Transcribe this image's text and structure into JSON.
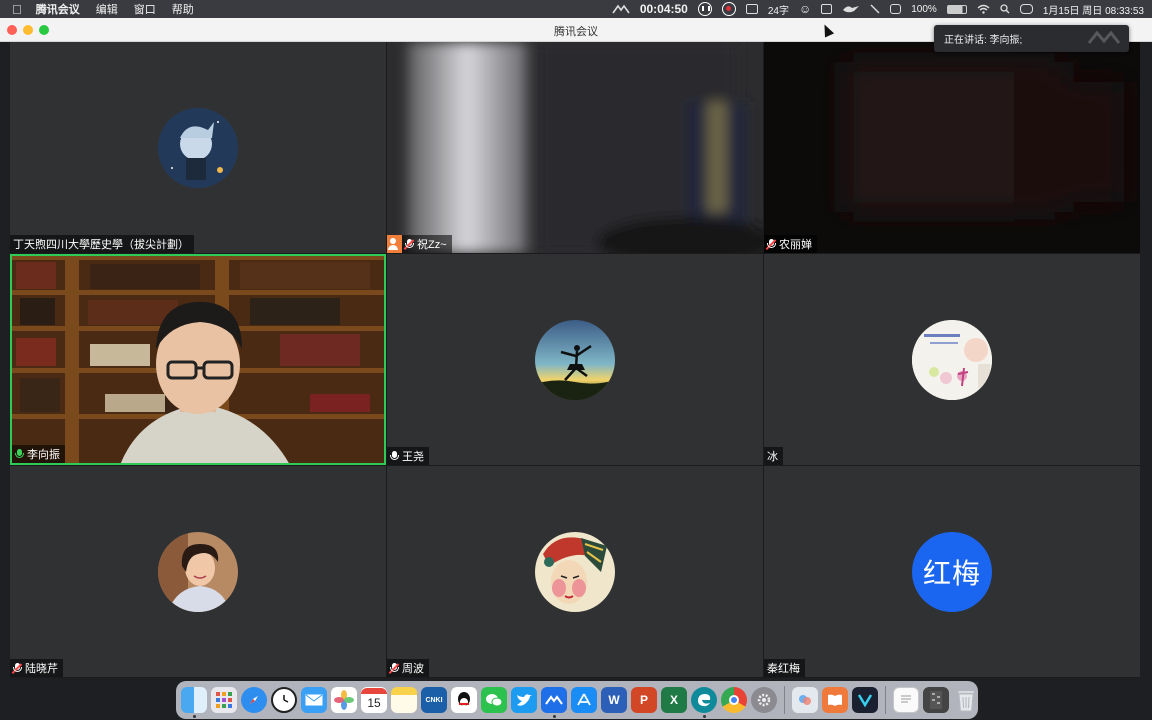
{
  "menubar": {
    "apple_icon": "apple-logo",
    "app_name": "腾讯会议",
    "menus": [
      "编辑",
      "窗口",
      "帮助"
    ],
    "timer": "00:04:50",
    "input_indicator": "24字",
    "battery": "100%",
    "datetime": "1月15日 周日  08:33:53"
  },
  "window": {
    "title": "腾讯会议"
  },
  "speaking": {
    "label": "正在讲话: 李向振;"
  },
  "colors": {
    "active_speaker": "#2ecc57",
    "tile_bg": "#303133",
    "hongmei_avatar": "#1a66f0"
  },
  "participants": [
    {
      "name": "丁天煦四川大學歷史學（拔尖計劃）",
      "mic": "none",
      "view": "avatar-anime"
    },
    {
      "name": "祝Zz~",
      "mic": "muted",
      "view": "video-curtain"
    },
    {
      "name": "农丽婵",
      "mic": "muted",
      "view": "video-dark"
    },
    {
      "name": "李向振",
      "mic": "active",
      "view": "video-speaker"
    },
    {
      "name": "王尧",
      "mic": "on",
      "view": "avatar-dancer"
    },
    {
      "name": "冰",
      "mic": "none",
      "view": "avatar-flowers"
    },
    {
      "name": "陆晓芹",
      "mic": "muted",
      "view": "avatar-woman"
    },
    {
      "name": "周波",
      "mic": "muted",
      "view": "avatar-opera"
    },
    {
      "name": "秦红梅",
      "mic": "none",
      "view": "avatar-initials",
      "initials": "红梅"
    }
  ],
  "dock": {
    "apps": [
      "Finder",
      "Launchpad",
      "Safari",
      "Clock",
      "Mail",
      "Photos",
      "Calendar",
      "Notes",
      "CNKI",
      "QQ",
      "WeChat",
      "Twitter",
      "Tencent Meeting",
      "App Store",
      "Word",
      "PowerPoint",
      "Excel",
      "Edge",
      "Chrome",
      "Settings"
    ],
    "calendar_day": "15",
    "cnki_label": "CNKI",
    "extras": [
      "Preview",
      "Books",
      "Canva",
      "Document",
      "Archive",
      "Trash"
    ]
  }
}
